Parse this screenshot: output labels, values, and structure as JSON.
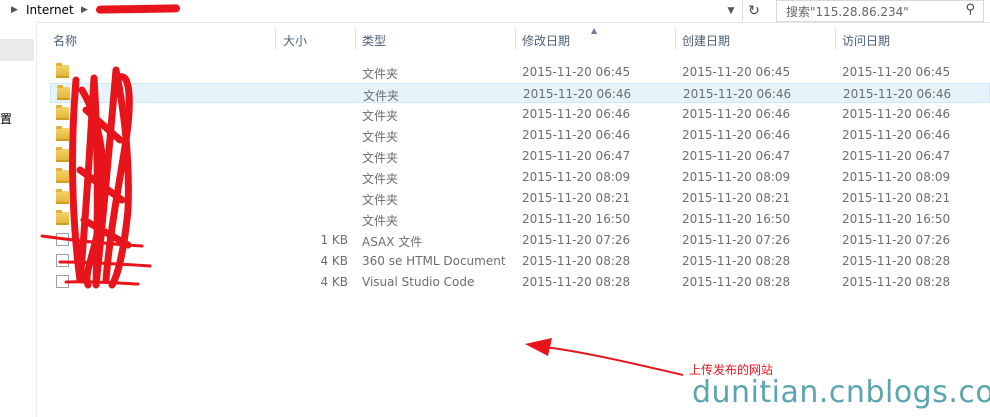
{
  "address": {
    "segment": "Internet",
    "refresh_icon": "refresh-icon",
    "dropdown_icon": "chevron-down-icon"
  },
  "search": {
    "placeholder": "搜索\"115.28.86.234\"",
    "icon": "search-icon"
  },
  "nav": {
    "partial_label": "置"
  },
  "columns": {
    "name": "名称",
    "size": "大小",
    "type": "类型",
    "modified": "修改日期",
    "created": "创建日期",
    "accessed": "访问日期"
  },
  "rows": [
    {
      "icon": "folder-icon",
      "name": "",
      "size": "",
      "type": "文件夹",
      "modified": "2015-11-20 06:45",
      "created": "2015-11-20 06:45",
      "accessed": "2015-11-20 06:45"
    },
    {
      "icon": "folder-icon",
      "name": "",
      "size": "",
      "type": "文件夹",
      "modified": "2015-11-20 06:46",
      "created": "2015-11-20 06:46",
      "accessed": "2015-11-20 06:46"
    },
    {
      "icon": "folder-icon",
      "name": "",
      "size": "",
      "type": "文件夹",
      "modified": "2015-11-20 06:46",
      "created": "2015-11-20 06:46",
      "accessed": "2015-11-20 06:46"
    },
    {
      "icon": "folder-icon",
      "name": "",
      "size": "",
      "type": "文件夹",
      "modified": "2015-11-20 06:46",
      "created": "2015-11-20 06:46",
      "accessed": "2015-11-20 06:46"
    },
    {
      "icon": "folder-icon",
      "name": "",
      "size": "",
      "type": "文件夹",
      "modified": "2015-11-20 06:47",
      "created": "2015-11-20 06:47",
      "accessed": "2015-11-20 06:47"
    },
    {
      "icon": "folder-icon",
      "name": "",
      "size": "",
      "type": "文件夹",
      "modified": "2015-11-20 08:09",
      "created": "2015-11-20 08:09",
      "accessed": "2015-11-20 08:09"
    },
    {
      "icon": "folder-icon",
      "name": "",
      "size": "",
      "type": "文件夹",
      "modified": "2015-11-20 08:21",
      "created": "2015-11-20 08:21",
      "accessed": "2015-11-20 08:21"
    },
    {
      "icon": "folder-icon",
      "name": "",
      "size": "",
      "type": "文件夹",
      "modified": "2015-11-20 16:50",
      "created": "2015-11-20 16:50",
      "accessed": "2015-11-20 16:50"
    },
    {
      "icon": "file-icon",
      "name": "",
      "size": "1 KB",
      "type": "ASAX 文件",
      "modified": "2015-11-20 07:26",
      "created": "2015-11-20 07:26",
      "accessed": "2015-11-20 07:26"
    },
    {
      "icon": "file-icon",
      "name": "",
      "size": "4 KB",
      "type": "360 se HTML Document",
      "modified": "2015-11-20 08:28",
      "created": "2015-11-20 08:28",
      "accessed": "2015-11-20 08:28"
    },
    {
      "icon": "file-icon",
      "name": "",
      "size": "4 KB",
      "type": "Visual Studio Code",
      "modified": "2015-11-20 08:28",
      "created": "2015-11-20 08:28",
      "accessed": "2015-11-20 08:28"
    }
  ],
  "selected_row": 1,
  "annotation": {
    "text": "上传发布的网站",
    "color": "#e8141b"
  },
  "watermark": {
    "text": "dunitian.cnblogs.com",
    "color": "#5aa5b0"
  },
  "colors": {
    "selection_bg": "#e5f3fb",
    "header_text": "#4c607a",
    "redaction": "#e8141b"
  }
}
